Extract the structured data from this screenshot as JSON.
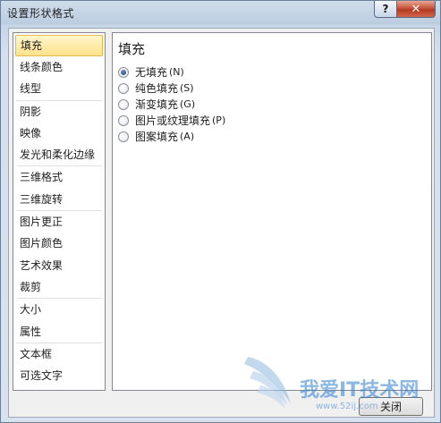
{
  "window": {
    "title": "设置形状格式",
    "help_label": "?",
    "close_label": "✕"
  },
  "nav": {
    "items": [
      {
        "label": "填充"
      },
      {
        "label": "线条颜色"
      },
      {
        "label": "线型"
      },
      {
        "label": "阴影"
      },
      {
        "label": "映像"
      },
      {
        "label": "发光和柔化边缘"
      },
      {
        "label": "三维格式"
      },
      {
        "label": "三维旋转"
      },
      {
        "label": "图片更正"
      },
      {
        "label": "图片颜色"
      },
      {
        "label": "艺术效果"
      },
      {
        "label": "裁剪"
      },
      {
        "label": "大小"
      },
      {
        "label": "属性"
      },
      {
        "label": "文本框"
      },
      {
        "label": "可选文字"
      }
    ],
    "selected": "填充"
  },
  "panel": {
    "title": "填充",
    "options": [
      {
        "label": "无填充",
        "shortcut": "(N)",
        "checked": true
      },
      {
        "label": "纯色填充",
        "shortcut": "(S)",
        "checked": false
      },
      {
        "label": "渐变填充",
        "shortcut": "(G)",
        "checked": false
      },
      {
        "label": "图片或纹理填充",
        "shortcut": "(P)",
        "checked": false
      },
      {
        "label": "图案填充",
        "shortcut": "(A)",
        "checked": false
      }
    ]
  },
  "footer": {
    "close_label": "关闭"
  },
  "watermark": {
    "text": "我爱IT技术网",
    "url": "www.52ij.com"
  },
  "colors": {
    "selected_bg": "#ffe28a",
    "selected_border": "#e3b74a",
    "close_button": "#c7553c",
    "frame": "#d4e0ed"
  }
}
